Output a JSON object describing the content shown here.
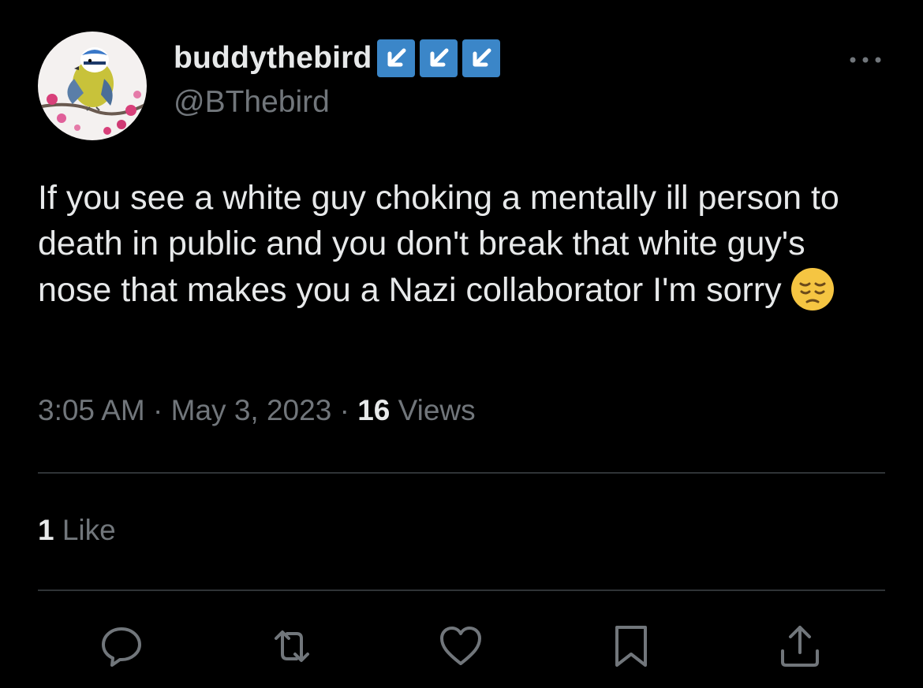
{
  "user": {
    "display_name": "buddythebird",
    "handle": "@BThebird",
    "badge_icon": "arrow-down-left-icon",
    "badge_color": "#3b86c8"
  },
  "tweet": {
    "text": "If you see a white guy choking a mentally ill person to death in public and you don't break that white guy's nose that makes you a Nazi collaborator I'm sorry",
    "emoji": "pensive-face-emoji",
    "time": "3:05 AM",
    "separator": "·",
    "date": "May 3, 2023",
    "views_count": "16",
    "views_label": "Views"
  },
  "engagement": {
    "likes_count": "1",
    "likes_label": "Like"
  },
  "actions": [
    "reply-icon",
    "retweet-icon",
    "like-icon",
    "bookmark-icon",
    "share-icon"
  ],
  "colors": {
    "background": "#000000",
    "primary_text": "#e7e9ea",
    "secondary_text": "#71767b",
    "divider": "#2f3336",
    "emoji_yellow": "#f5c542"
  }
}
